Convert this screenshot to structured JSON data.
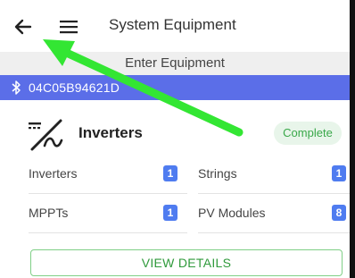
{
  "header": {
    "title": "System Equipment"
  },
  "subheader": {
    "label": "Enter Equipment"
  },
  "bluetooth": {
    "device_id": "04C05B94621D"
  },
  "card": {
    "title": "Inverters",
    "status": "Complete",
    "rows": [
      [
        {
          "label": "Inverters",
          "count": "1"
        },
        {
          "label": "Strings",
          "count": "1"
        }
      ],
      [
        {
          "label": "MPPTs",
          "count": "1"
        },
        {
          "label": "PV Modules",
          "count": "8"
        }
      ]
    ],
    "button_label": "VIEW DETAILS"
  },
  "colors": {
    "bluetooth_bar": "#5b6ee8",
    "status_bg": "#e8f5ea",
    "status_text": "#39a849",
    "badge": "#4f7cf0",
    "annotation_arrow": "#33e633"
  }
}
